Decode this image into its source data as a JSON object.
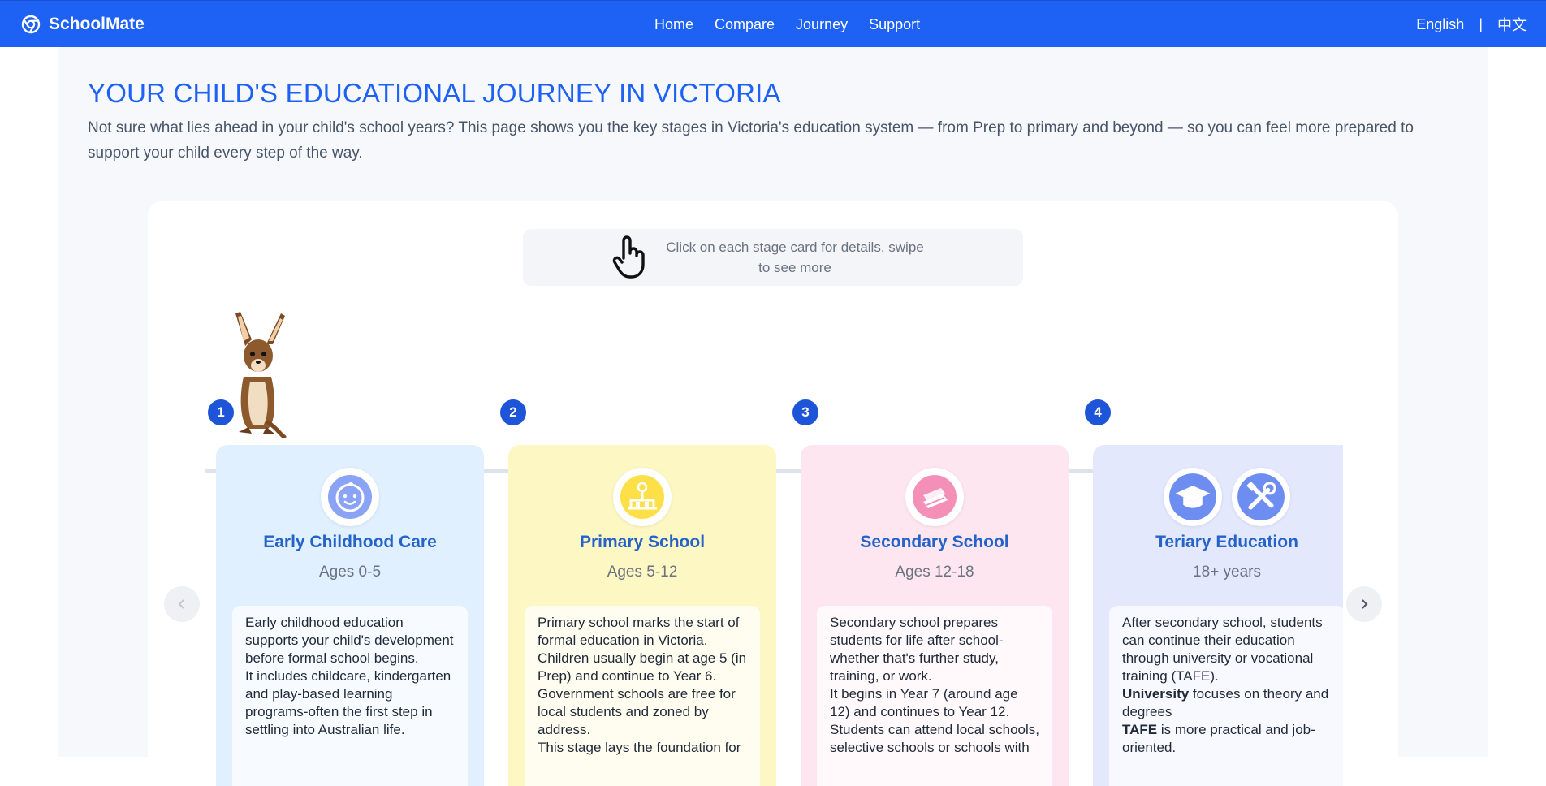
{
  "nav": {
    "brand": "SchoolMate",
    "links": [
      "Home",
      "Compare",
      "Journey",
      "Support"
    ],
    "active": "Journey",
    "lang_en": "English",
    "lang_sep": "|",
    "lang_zh": "中文"
  },
  "page": {
    "title": "YOUR CHILD'S EDUCATIONAL JOURNEY IN VICTORIA",
    "intro": "Not sure what lies ahead in your child's school years? This page shows you the key stages in Victoria's education system — from Prep to primary and beyond — so you can feel more prepared to support your child every step of the way."
  },
  "hint": {
    "text": "Click on each stage card for details, swipe to see more",
    "icon": "hand-pointer-icon"
  },
  "stages": [
    {
      "number": "1",
      "title": "Early Childhood Care",
      "ages": "Ages 0-5",
      "icon": "baby-face-icon",
      "color": "#e0f0ff",
      "icon_color": "#8aa3f5",
      "body": [
        "Early childhood education supports your child's development before formal school begins.",
        "It includes childcare, kindergarten and play-based learning programs-often the first step in settling into Australian life."
      ]
    },
    {
      "number": "2",
      "title": "Primary School",
      "ages": "Ages 5-12",
      "icon": "school-building-icon",
      "color": "#fdf7c3",
      "icon_color": "#fde047",
      "body": [
        "Primary school marks the start of formal education in Victoria. Children usually begin at age 5 (in Prep) and continue to Year 6.",
        "Government schools are free for local students and zoned by address.",
        "This stage lays the foundation for"
      ]
    },
    {
      "number": "3",
      "title": "Secondary School",
      "ages": "Ages 12-18",
      "icon": "books-icon",
      "color": "#fde6f0",
      "icon_color": "#f48fb8",
      "body": [
        "Secondary school prepares students for life after school-whether that's further study, training, or work.",
        "It begins in Year 7 (around age 12) and continues to Year 12. Students can attend local schools, selective schools or schools with"
      ]
    },
    {
      "number": "4",
      "title": "Teriary Education",
      "ages": "18+ years",
      "icon": "graduation-cap-icon",
      "icon2": "tools-icon",
      "color": "#e3e8fc",
      "icon_color": "#6d8ef0",
      "body_intro": "After secondary school, students can continue their education through university or vocational training (TAFE).",
      "body_uni_label": "University",
      "body_uni_text": " focuses on theory and degrees",
      "body_tafe_label": "TAFE",
      "body_tafe_text": " is more practical and job-oriented."
    }
  ],
  "arrows": {
    "prev": "chevron-left-icon",
    "next": "chevron-right-icon"
  }
}
